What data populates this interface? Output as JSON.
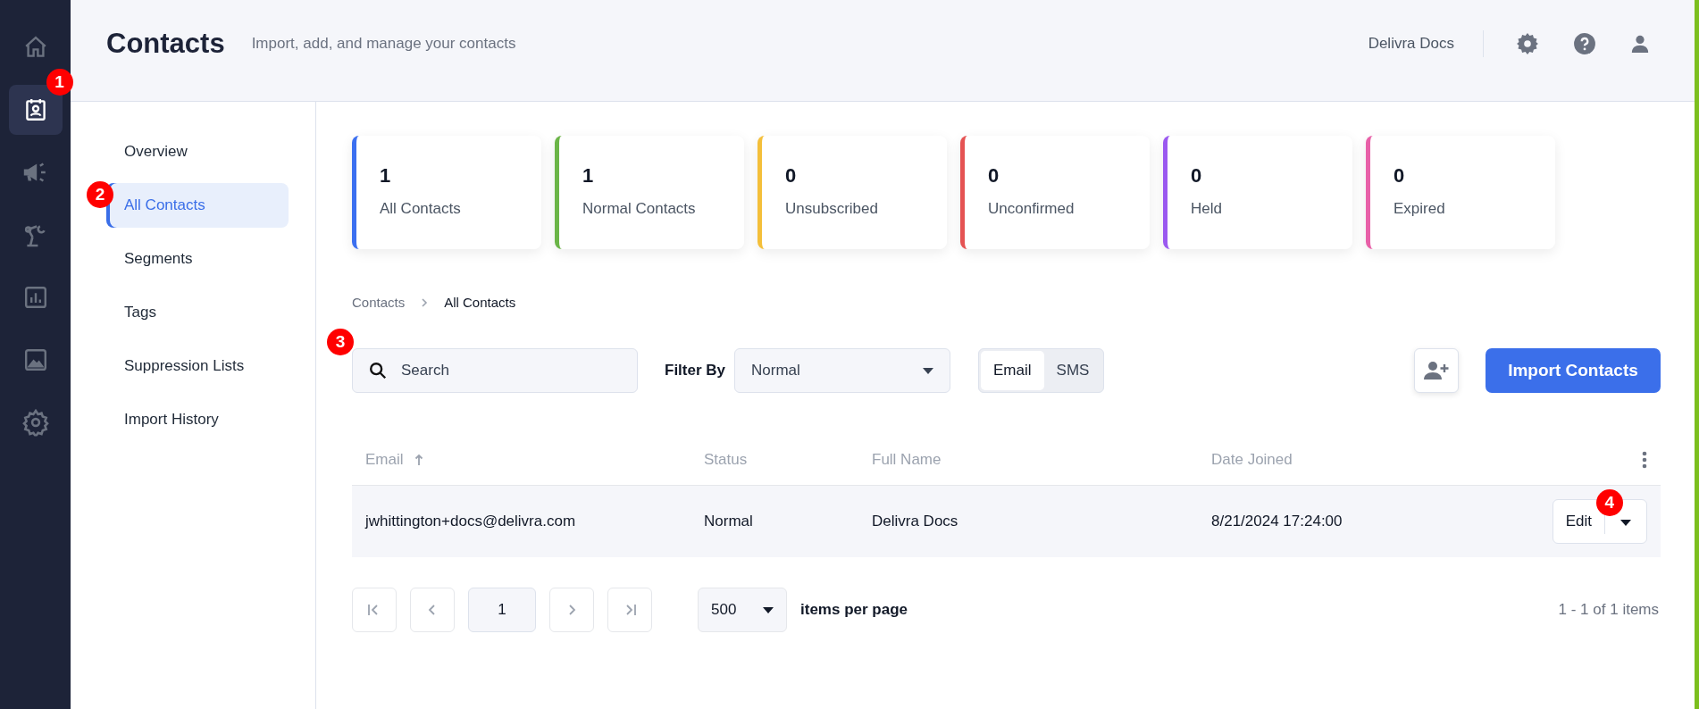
{
  "rail": [
    {
      "selected": false
    },
    {
      "selected": true,
      "badge": "1"
    },
    {
      "selected": false
    },
    {
      "selected": false
    },
    {
      "selected": false
    },
    {
      "selected": false
    },
    {
      "selected": false
    }
  ],
  "header": {
    "title": "Contacts",
    "subtitle": "Import, add, and manage your contacts",
    "account": "Delivra Docs"
  },
  "subnav": [
    {
      "label": "Overview",
      "selected": false
    },
    {
      "label": "All Contacts",
      "selected": true,
      "badge": "2"
    },
    {
      "label": "Segments",
      "selected": false
    },
    {
      "label": "Tags",
      "selected": false
    },
    {
      "label": "Suppression Lists",
      "selected": false
    },
    {
      "label": "Import History",
      "selected": false
    }
  ],
  "stats": [
    {
      "value": "1",
      "label": "All Contacts",
      "color": "#3b6ff0"
    },
    {
      "value": "1",
      "label": "Normal Contacts",
      "color": "#6bb548"
    },
    {
      "value": "0",
      "label": "Unsubscribed",
      "color": "#f4bf3a"
    },
    {
      "value": "0",
      "label": "Unconfirmed",
      "color": "#e55353"
    },
    {
      "value": "0",
      "label": "Held",
      "color": "#9b59f0"
    },
    {
      "value": "0",
      "label": "Expired",
      "color": "#e860a8"
    }
  ],
  "breadcrumb": [
    "Contacts",
    "All Contacts"
  ],
  "toolbar": {
    "search": {
      "placeholder": "Search",
      "badge": "3"
    },
    "filter_label": "Filter By",
    "filter_value": "Normal",
    "channels": [
      {
        "label": "Email",
        "selected": true
      },
      {
        "label": "SMS",
        "selected": false
      }
    ],
    "import_button": "Import Contacts"
  },
  "table": {
    "columns": [
      "Email",
      "Status",
      "Full Name",
      "Date Joined"
    ],
    "rows": [
      {
        "email": "jwhittington+docs@delivra.com",
        "status": "Normal",
        "full_name": "Delivra Docs",
        "date_joined": "8/21/2024 17:24:00",
        "action": "Edit",
        "badge": "4"
      }
    ]
  },
  "pager": {
    "page": "1",
    "page_size": "500",
    "page_size_label": "items per page",
    "summary": "1 - 1 of 1 items"
  }
}
